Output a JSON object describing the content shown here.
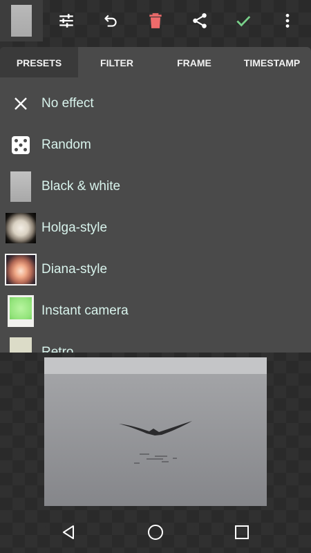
{
  "toolbar": {
    "icons": [
      "thumbnail",
      "adjust-sliders-icon",
      "undo-icon",
      "delete-icon",
      "share-icon",
      "check-icon",
      "more-vert-icon"
    ],
    "accent_colors": {
      "delete": "#ef6b6b",
      "check": "#79d08a"
    }
  },
  "tabs": [
    {
      "label": "PRESETS",
      "active": true
    },
    {
      "label": "FILTER",
      "active": false
    },
    {
      "label": "FRAME",
      "active": false
    },
    {
      "label": "TIMESTAMP",
      "active": false
    }
  ],
  "presets": [
    {
      "label": "No effect",
      "icon": "close-icon"
    },
    {
      "label": "Random",
      "icon": "dice-icon"
    },
    {
      "label": "Black & white",
      "icon": "bw-preview"
    },
    {
      "label": "Holga-style",
      "icon": "holga-preview"
    },
    {
      "label": "Diana-style",
      "icon": "diana-preview"
    },
    {
      "label": "Instant camera",
      "icon": "instant-preview"
    },
    {
      "label": "Retro",
      "icon": "retro-preview"
    }
  ],
  "navbar": {
    "icons": [
      "back-icon",
      "home-icon",
      "recents-icon"
    ]
  }
}
